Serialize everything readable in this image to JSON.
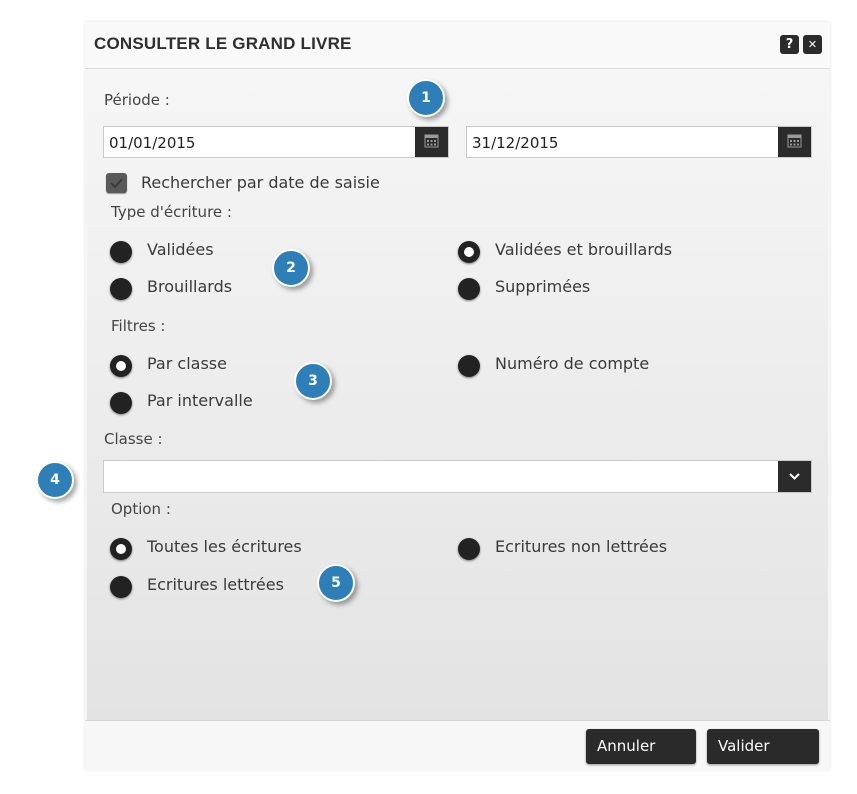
{
  "dialog": {
    "title": "CONSULTER LE GRAND LIVRE",
    "help_label": "?",
    "close_label": "✕"
  },
  "periode": {
    "label": "Période :",
    "start_date": "01/01/2015",
    "end_date": "31/12/2015"
  },
  "search_by_entry_date": {
    "label": "Rechercher par date de saisie",
    "checked": true
  },
  "type_ecriture": {
    "label": "Type d'écriture :",
    "options": [
      {
        "label": "Validées",
        "selected": false
      },
      {
        "label": "Validées et brouillards",
        "selected": true
      },
      {
        "label": "Brouillards",
        "selected": false
      },
      {
        "label": "Supprimées",
        "selected": false
      }
    ]
  },
  "filtres": {
    "label": "Filtres :",
    "options": [
      {
        "label": "Par classe",
        "selected": true
      },
      {
        "label": "Numéro de compte",
        "selected": false
      },
      {
        "label": "Par intervalle",
        "selected": false
      }
    ]
  },
  "classe": {
    "label": "Classe :",
    "value": ""
  },
  "option": {
    "label": "Option :",
    "options": [
      {
        "label": "Toutes les écritures",
        "selected": true
      },
      {
        "label": "Ecritures non lettrées",
        "selected": false
      },
      {
        "label": "Ecritures lettrées",
        "selected": false
      }
    ]
  },
  "footer": {
    "cancel_label": "Annuler",
    "submit_label": "Valider"
  },
  "markers": [
    "1",
    "2",
    "3",
    "4",
    "5"
  ],
  "colors": {
    "marker": "#2e7fb8",
    "button": "#2a2a2a"
  }
}
